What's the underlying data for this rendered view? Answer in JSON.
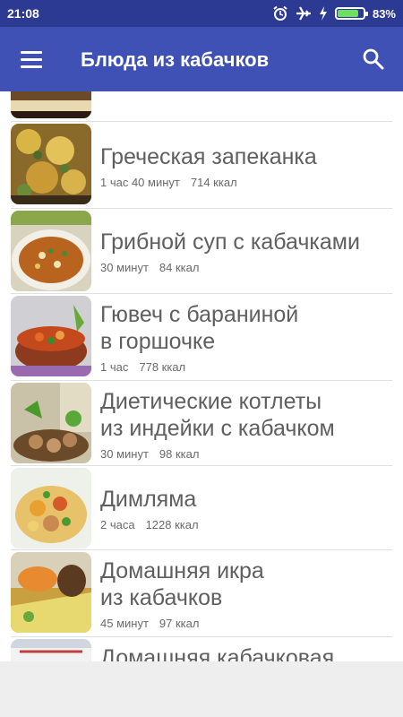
{
  "status_bar": {
    "time": "21:08",
    "battery_percent": "83%",
    "battery_level": 0.83,
    "icons": [
      "alarm-icon",
      "airplane-icon",
      "charging-icon",
      "battery-icon"
    ]
  },
  "app_bar": {
    "menu_icon": "menu-icon",
    "title": "Блюда из кабачков",
    "search_icon": "search-icon",
    "color": "#3f51b5"
  },
  "recipes": [
    {
      "title_lines": [
        "Греческая запеканка"
      ],
      "time": "1 час 40 минут",
      "calories": "714 ккал"
    },
    {
      "title_lines": [
        "Грибной суп с кабачками"
      ],
      "time": "30 минут",
      "calories": "84 ккал"
    },
    {
      "title_lines": [
        "Гювеч с бараниной",
        "в горшочке"
      ],
      "time": "1 час",
      "calories": "778 ккал"
    },
    {
      "title_lines": [
        "Диетические котлеты",
        "из индейки с кабачком"
      ],
      "time": "30 минут",
      "calories": "98 ккал"
    },
    {
      "title_lines": [
        "Димляма"
      ],
      "time": "2 часа",
      "calories": "1228 ккал"
    },
    {
      "title_lines": [
        "Домашняя икра",
        "из кабачков"
      ],
      "time": "45 минут",
      "calories": "97 ккал"
    },
    {
      "title_lines": [
        "Домашняя кабачковая"
      ]
    }
  ]
}
